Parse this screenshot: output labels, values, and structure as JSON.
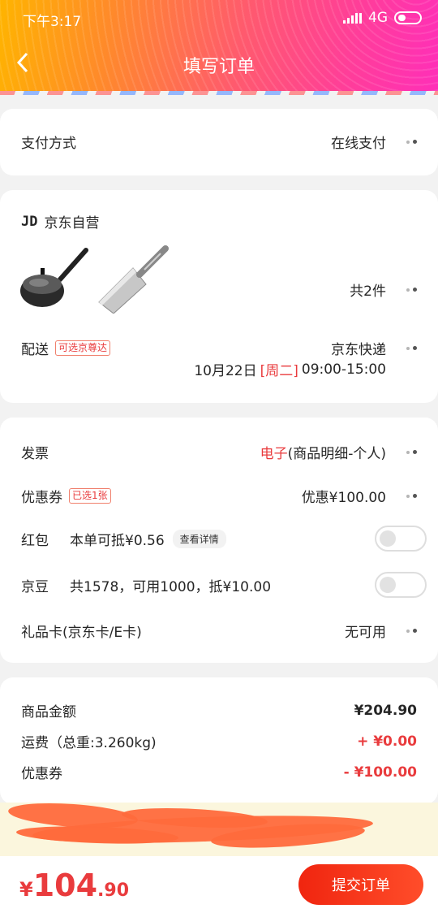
{
  "status_bar": {
    "time": "下午3:17",
    "network": "4G"
  },
  "header": {
    "title": "填写订单"
  },
  "payment": {
    "label": "支付方式",
    "value": "在线支付"
  },
  "shop": {
    "name_prefix": "JD",
    "name": "京东自营",
    "item_count": "共2件",
    "products": [
      "wok-icon",
      "cleaver-icon"
    ],
    "delivery_label": "配送",
    "delivery_tag": "可选京尊达",
    "courier": "京东快递",
    "date": "10月22日",
    "weekday": "[周二]",
    "time_window": "09:00-15:00"
  },
  "options": {
    "invoice_label": "发票",
    "invoice_type": "电子",
    "invoice_detail": "(商品明细-个人)",
    "coupon_label": "优惠券",
    "coupon_tag": "已选1张",
    "coupon_value": "优惠¥100.00",
    "redpacket_label": "红包",
    "redpacket_text": "本单可抵¥0.56",
    "redpacket_link": "查看详情",
    "redpacket_on": false,
    "jingdou_label": "京豆",
    "jingdou_text": "共1578，可用1000，抵¥10.00",
    "jingdou_on": false,
    "giftcard_label": "礼品卡(京东卡/E卡)",
    "giftcard_value": "无可用"
  },
  "summary": {
    "goods_label": "商品金额",
    "goods_value": "¥204.90",
    "shipping_label": "运费（总重:3.260kg)",
    "shipping_value": "+ ¥0.00",
    "coupon_label": "优惠券",
    "coupon_value": "- ¥100.00"
  },
  "footer": {
    "currency": "¥",
    "total_int": "104",
    "total_dec": ".90",
    "submit_label": "提交订单"
  },
  "colors": {
    "accent": "#e93b3d",
    "header_start": "#ffb400",
    "header_end": "#ff2fb8"
  }
}
